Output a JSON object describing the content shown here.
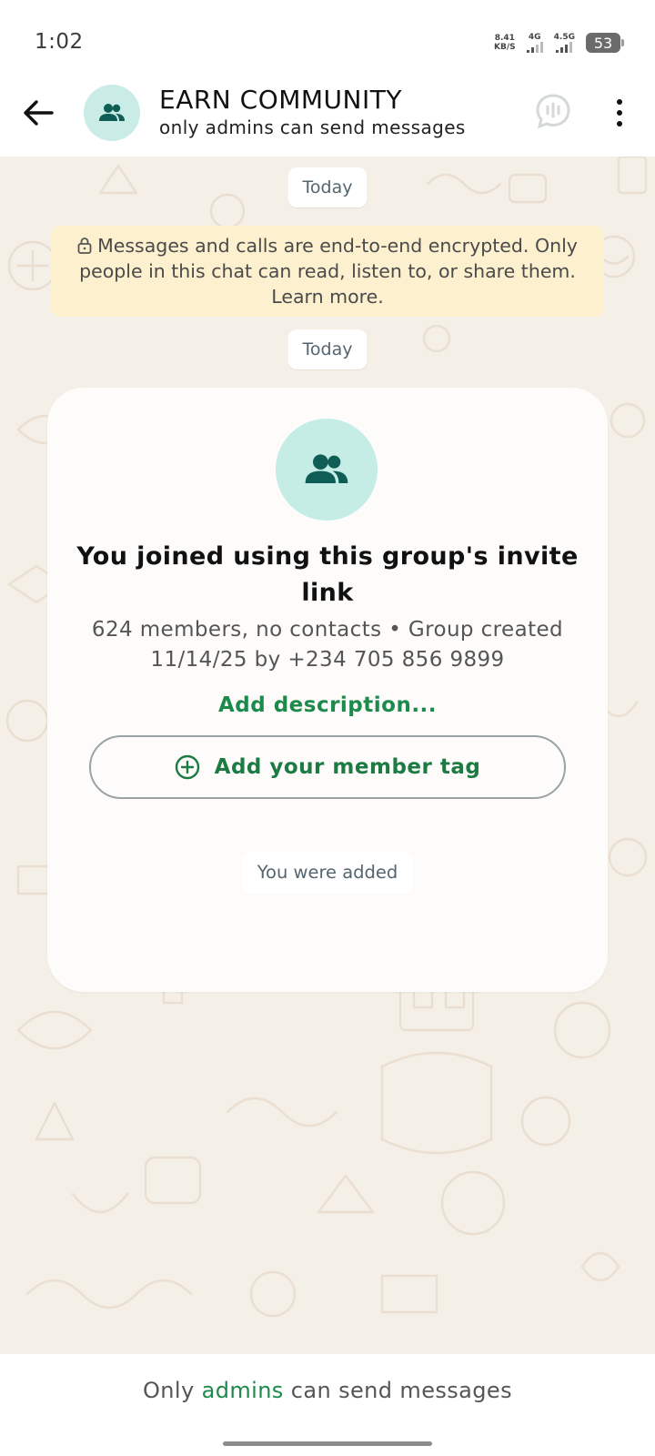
{
  "status_bar": {
    "time": "1:02",
    "net_speed_value": "8.41",
    "net_speed_unit": "KB/S",
    "signal_1_label": "4G",
    "signal_2_label": "4.5G",
    "battery": "53"
  },
  "header": {
    "title": "EARN COMMUNITY",
    "subtitle": "only admins can send messages",
    "avatar_icon": "group-icon",
    "call_icon": "voice-chat-icon",
    "menu_icon": "more-vertical-icon"
  },
  "chat": {
    "date_chip_1": "Today",
    "encryption_notice": "Messages and calls are end-to-end encrypted. Only people in this chat can read, listen to, or share them. Learn more.",
    "date_chip_2": "Today",
    "card": {
      "title": "You joined using this group's invite link",
      "meta": "624 members, no contacts • Group created 11/14/25 by +234 705 856 9899",
      "description_link": "Add description...",
      "member_tag_button": "Add your member tag"
    },
    "system_message": "You were added"
  },
  "footer": {
    "text_before": "Only ",
    "link": "admins",
    "text_after": " can send messages"
  },
  "colors": {
    "accent_green": "#1c8a4a",
    "chat_background": "#f4efe7",
    "notice_background": "#fdf0cf",
    "avatar_background": "#c9ece7",
    "icon_teal": "#0e5e56"
  }
}
